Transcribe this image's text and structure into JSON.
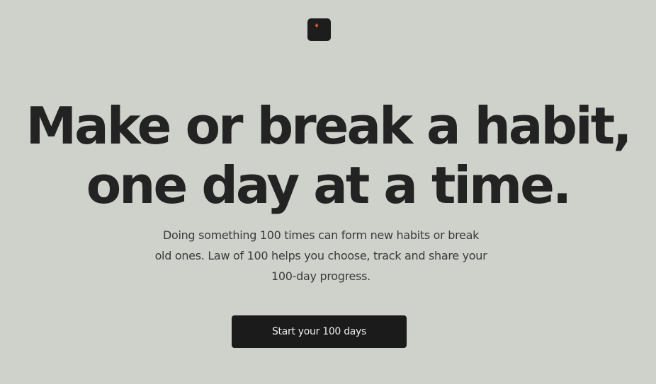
{
  "brand": {
    "logo_icon": "flame-icon",
    "logo_bg": "#1d1d1d",
    "accent": "#e0532a"
  },
  "hero": {
    "headline_line1": "Make or break a habit,",
    "headline_line2": "one day at a time.",
    "subtitle_line1": "Doing something 100 times can form new habits or break",
    "subtitle_line2": "old ones. Law of 100 helps you choose, track and share your",
    "subtitle_line3": "100-day progress.",
    "cta_label": "Start your 100 days"
  },
  "colors": {
    "background": "#cfd1cb",
    "text": "#232323",
    "button_bg": "#1b1b1b",
    "button_text": "#ededed"
  }
}
